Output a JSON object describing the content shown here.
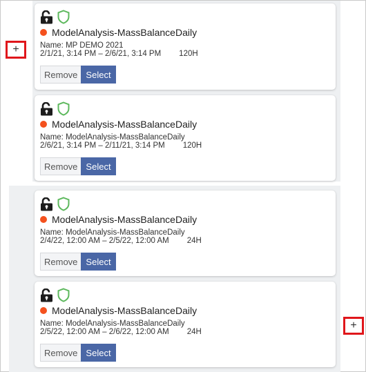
{
  "colors": {
    "accent_select": "#4a67a6",
    "status_dot": "#f4511e",
    "shield": "#5cb85c",
    "highlight_box": "#e0161b"
  },
  "plus_label": "+",
  "cards": [
    {
      "icons": [
        "unlock-icon",
        "shield-icon"
      ],
      "title": "ModelAnalysis-MassBalanceDaily",
      "name": "Name: MP DEMO 2021",
      "range": "2/1/21, 3:14 PM – 2/6/21, 3:14 PM",
      "duration": "120H",
      "remove_label": "Remove",
      "select_label": "Select"
    },
    {
      "icons": [
        "unlock-icon",
        "shield-icon"
      ],
      "title": "ModelAnalysis-MassBalanceDaily",
      "name": "Name: ModelAnalysis-MassBalanceDaily",
      "range": "2/6/21, 3:14 PM – 2/11/21, 3:14 PM",
      "duration": "120H",
      "remove_label": "Remove",
      "select_label": "Select"
    },
    {
      "icons": [
        "unlock-icon",
        "shield-icon"
      ],
      "title": "ModelAnalysis-MassBalanceDaily",
      "name": "Name: ModelAnalysis-MassBalanceDaily",
      "range": "2/4/22, 12:00 AM – 2/5/22, 12:00 AM",
      "duration": "24H",
      "remove_label": "Remove",
      "select_label": "Select"
    },
    {
      "icons": [
        "unlock-icon",
        "shield-icon"
      ],
      "title": "ModelAnalysis-MassBalanceDaily",
      "name": "Name: ModelAnalysis-MassBalanceDaily",
      "range": "2/5/22, 12:00 AM – 2/6/22, 12:00 AM",
      "duration": "24H",
      "remove_label": "Remove",
      "select_label": "Select"
    }
  ]
}
